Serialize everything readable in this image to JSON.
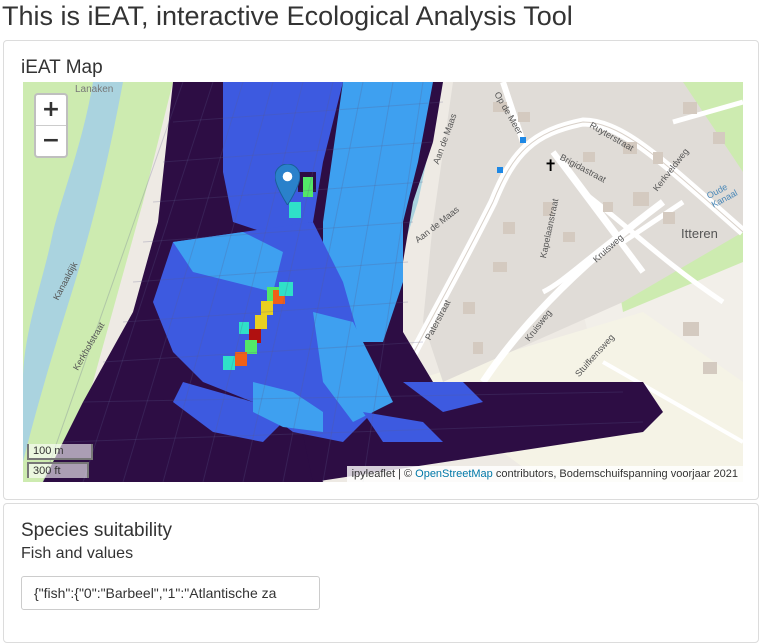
{
  "page": {
    "title": "This is iEAT, interactive Ecological Analysis Tool"
  },
  "map_panel": {
    "heading": "iEAT Map",
    "zoom_in": "+",
    "zoom_out": "−",
    "scale": {
      "metric": "100 m",
      "imperial": "300 ft"
    },
    "attribution": {
      "prefix": "ipyleaflet | © ",
      "link": "OpenStreetMap",
      "suffix": " contributors, Bodemschuifspanning voorjaar 2021"
    },
    "place_labels": {
      "lanaken": "Lanaken",
      "kanaaldijk": "Kanaaldijk",
      "kerkhofstraat": "Kerkhofstraat",
      "aan_de_maas_1": "Aan de Maas",
      "aan_de_maas_2": "Aan de Maas",
      "op_de_meer": "Op de Meer",
      "ruyterstraat": "Ruyterstraat",
      "kerkveldweg": "Kerkveldweg",
      "brigidastraat": "Brigidastraat",
      "kapelaanstraat": "Kapelaanstraat",
      "kruisweg_1": "Kruisweg",
      "kruisweg_2": "Kruisweg",
      "paterstraat": "Paterstraat",
      "stuifkensweg": "Stuifkensweg",
      "itteren": "Itteren",
      "oude_kanaal": "Oude Kanaal"
    },
    "icons": [
      "map-marker-icon",
      "church-cross-icon"
    ],
    "colors": {
      "deep_purple": "#2d0d44",
      "blue": "#3d5ae0",
      "light_blue": "#3ea0f0",
      "cyan": "#2fe0c8",
      "green": "#52e868",
      "yellow": "#e8d020",
      "orange": "#f06018",
      "red": "#b01010"
    }
  },
  "species_panel": {
    "heading": "Species suitability",
    "subheading": "Fish and values",
    "input_value": "{\"fish\":{\"0\":\"Barbeel\",\"1\":\"Atlantische za"
  }
}
